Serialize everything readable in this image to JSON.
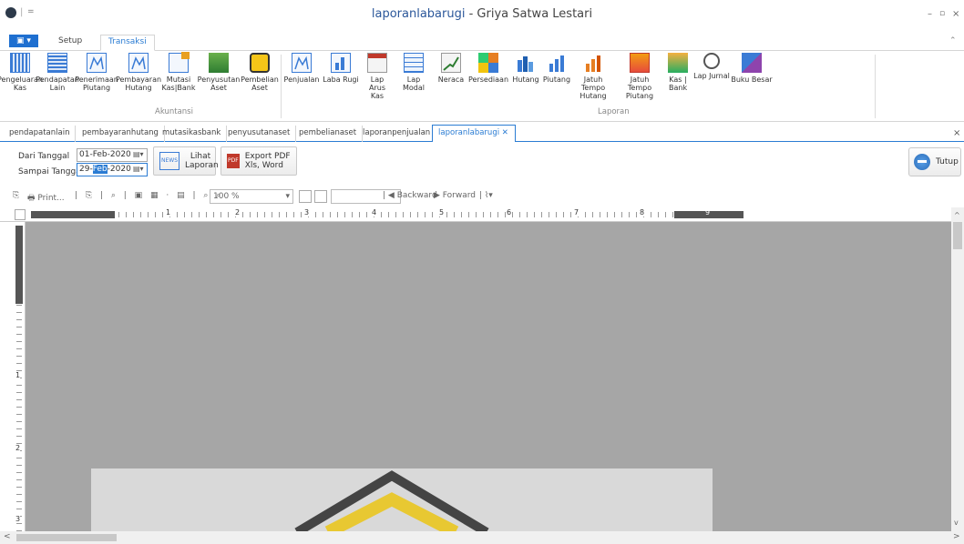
{
  "window": {
    "title_main": "laporanlabarugi",
    "title_sep": " - ",
    "title_sub": "Griya Satwa Lestari"
  },
  "ribbon_tabs": [
    {
      "label": "Setup"
    },
    {
      "label": "Transaksi"
    }
  ],
  "ribbon": {
    "akuntansi": [
      {
        "label": "Pengeluaran Kas",
        "icon": "book-icon"
      },
      {
        "label": "Pendapatan Lain",
        "icon": "ledger-icon"
      },
      {
        "label": "Penerimaan Piutang",
        "icon": "chart-icon"
      },
      {
        "label": "Pembayaran Hutang",
        "icon": "chart-icon"
      },
      {
        "label": "Mutasi Kas|Bank",
        "icon": "transfer-icon"
      },
      {
        "label": "Penyusutan Aset",
        "icon": "asset-icon"
      },
      {
        "label": "Pembelian Aset",
        "icon": "bus-icon"
      }
    ],
    "laporan": [
      {
        "label": "Penjualan"
      },
      {
        "label": "Laba Rugi"
      },
      {
        "label": "Lap Arus Kas"
      },
      {
        "label": "Lap Modal"
      },
      {
        "label": "Neraca"
      },
      {
        "label": "Persediaan"
      },
      {
        "label": "Hutang"
      },
      {
        "label": "Piutang"
      },
      {
        "label": "Jatuh Tempo Hutang"
      },
      {
        "label": "Jatuh Tempo Piutang"
      },
      {
        "label": "Kas | Bank"
      },
      {
        "label": "Lap Jurnal"
      },
      {
        "label": "Buku Besar"
      }
    ],
    "group_akuntansi": "Akuntansi",
    "group_laporan": "Laporan"
  },
  "doc_tabs": [
    {
      "label": "pendapatanlain"
    },
    {
      "label": "pembayaranhutang"
    },
    {
      "label": "mutasikasbank"
    },
    {
      "label": "penyusutanaset"
    },
    {
      "label": "pembelianaset"
    },
    {
      "label": "laporanpenjualan"
    },
    {
      "label": "laporanlabarugi"
    }
  ],
  "filters": {
    "dari_label": "Dari Tanggal",
    "dari_value": "01-Feb-2020",
    "sampai_label": "Sampai Tanggal",
    "sampai_pre": "29-",
    "sampai_sel": "Feb",
    "sampai_post": "-2020",
    "lihat_label": "Lihat Laporan",
    "lihat_icon_text": "NEWS",
    "export_label": "Export PDF Xls, Word",
    "export_icon_text": "PDF",
    "tutup_label": "Tutup"
  },
  "toolbar": {
    "print": "Print...",
    "zoom": "100 %",
    "backward": "Backward",
    "forward": "Forward"
  },
  "ruler": {
    "marks": [
      "1",
      "2",
      "3",
      "4",
      "5",
      "6",
      "7",
      "8",
      "9"
    ],
    "vmarks": [
      "1",
      "2",
      "3"
    ]
  },
  "colors": {
    "accent": "#2b7cd3",
    "canvas": "#a6a6a6"
  }
}
